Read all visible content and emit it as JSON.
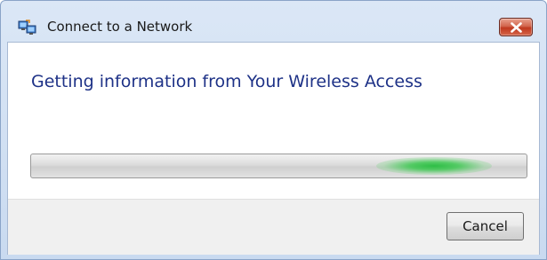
{
  "window": {
    "title": "Connect to a Network",
    "icon": "network-connect-icon",
    "close_icon": "close-icon"
  },
  "main": {
    "heading": "Getting information from Your Wireless Access",
    "progress": {
      "style": "indeterminate-marquee",
      "accent_color": "#2ebe46"
    }
  },
  "footer": {
    "cancel_label": "Cancel"
  },
  "colors": {
    "heading": "#1e3287",
    "close_button": "#c0391f",
    "frame": "#c9daf0"
  }
}
